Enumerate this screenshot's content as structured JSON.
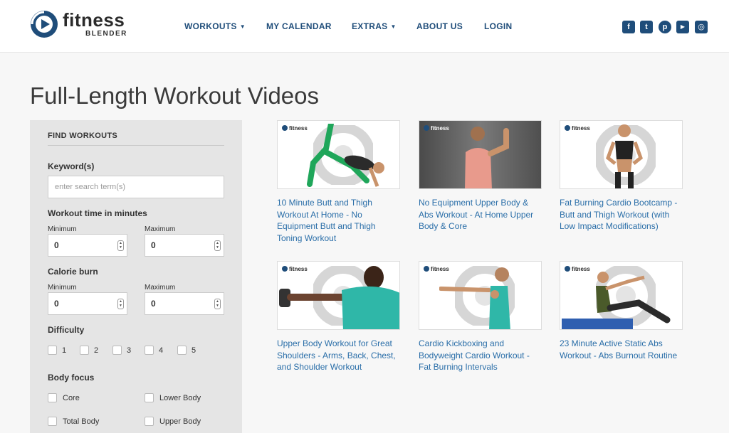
{
  "brand": {
    "name": "fitness",
    "sub": "BLENDER",
    "accent": "#1f4d7a",
    "link_color": "#2a6ea8"
  },
  "nav": [
    {
      "label": "WORKOUTS",
      "has_dropdown": true
    },
    {
      "label": "MY CALENDAR",
      "has_dropdown": false
    },
    {
      "label": "EXTRAS",
      "has_dropdown": true
    },
    {
      "label": "ABOUT US",
      "has_dropdown": false
    },
    {
      "label": "LOGIN",
      "has_dropdown": false
    }
  ],
  "social": [
    {
      "icon": "facebook-icon",
      "glyph": "f"
    },
    {
      "icon": "twitter-icon",
      "glyph": "t"
    },
    {
      "icon": "pinterest-icon",
      "glyph": "p"
    },
    {
      "icon": "youtube-icon",
      "glyph": "▶"
    },
    {
      "icon": "instagram-icon",
      "glyph": "◎"
    }
  ],
  "page_title": "Full-Length Workout Videos",
  "filter": {
    "heading": "FIND WORKOUTS",
    "keyword_label": "Keyword(s)",
    "keyword_placeholder": "enter search term(s)",
    "time_label": "Workout time in minutes",
    "calorie_label": "Calorie burn",
    "min_label": "Minimum",
    "max_label": "Maximum",
    "time_min": "0",
    "time_max": "0",
    "cal_min": "0",
    "cal_max": "0",
    "difficulty_label": "Difficulty",
    "difficulty_options": [
      "1",
      "2",
      "3",
      "4",
      "5"
    ],
    "body_focus_label": "Body focus",
    "body_focus_options": [
      "Core",
      "Lower Body",
      "Total Body",
      "Upper Body"
    ]
  },
  "videos": [
    {
      "title": "10 Minute Butt and Thigh Workout At Home - No Equipment Butt and Thigh Toning Workout",
      "thumb_style": "light"
    },
    {
      "title": "No Equipment Upper Body & Abs Workout - At Home Upper Body & Core",
      "thumb_style": "dark"
    },
    {
      "title": "Fat Burning Cardio Bootcamp - Butt and Thigh Workout (with Low Impact Modifications)",
      "thumb_style": "light"
    },
    {
      "title": "Upper Body Workout for Great Shoulders - Arms, Back, Chest, and Shoulder Workout",
      "thumb_style": "light"
    },
    {
      "title": "Cardio Kickboxing and Bodyweight Cardio Workout - Fat Burning Intervals",
      "thumb_style": "light"
    },
    {
      "title": "23 Minute Active Static Abs Workout - Abs Burnout Routine",
      "thumb_style": "light"
    }
  ],
  "thumb_logo_text": "fitness"
}
